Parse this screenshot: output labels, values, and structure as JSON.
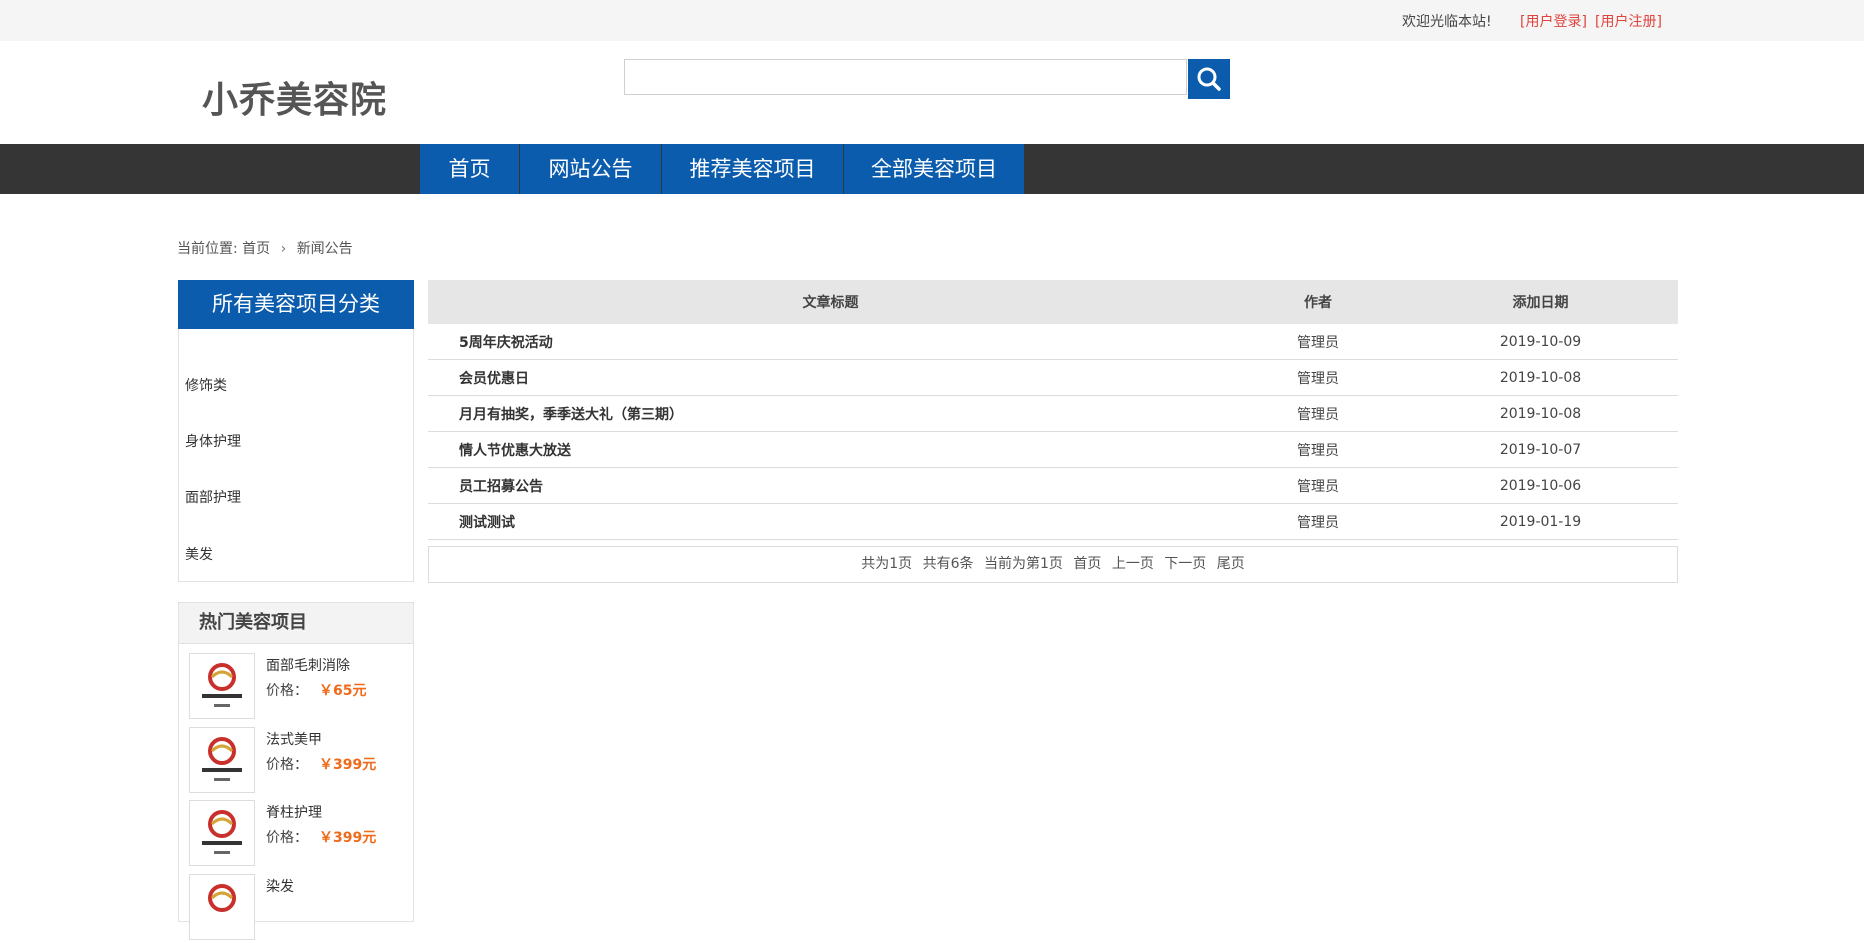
{
  "topbar": {
    "welcome": "欢迎光临本站!",
    "login": "[用户登录]",
    "register": "[用户注册]"
  },
  "header": {
    "logo": "小乔美容院",
    "search_placeholder": ""
  },
  "nav": [
    {
      "label": "首页"
    },
    {
      "label": "网站公告"
    },
    {
      "label": "推荐美容项目"
    },
    {
      "label": "全部美容项目"
    }
  ],
  "breadcrumb": {
    "prefix": "当前位置:",
    "home": "首页",
    "current": "新闻公告"
  },
  "sidebar": {
    "category_title": "所有美容项目分类",
    "categories": [
      "修饰类",
      "身体护理",
      "面部护理",
      "美发"
    ],
    "hot_title": "热门美容项目",
    "price_label": "价格：",
    "hot_items": [
      {
        "name": "面部毛刺消除",
        "price": "￥65元"
      },
      {
        "name": "法式美甲",
        "price": "￥399元"
      },
      {
        "name": "脊柱护理",
        "price": "￥399元"
      },
      {
        "name": "染发",
        "price": ""
      }
    ]
  },
  "table": {
    "headers": [
      "文章标题",
      "作者",
      "添加日期"
    ],
    "rows": [
      {
        "title": "5周年庆祝活动",
        "author": "管理员",
        "date": "2019-10-09"
      },
      {
        "title": "会员优惠日",
        "author": "管理员",
        "date": "2019-10-08"
      },
      {
        "title": "月月有抽奖，季季送大礼（第三期）",
        "author": "管理员",
        "date": "2019-10-08"
      },
      {
        "title": "情人节优惠大放送",
        "author": "管理员",
        "date": "2019-10-07"
      },
      {
        "title": "员工招募公告",
        "author": "管理员",
        "date": "2019-10-06"
      },
      {
        "title": "测试测试",
        "author": "管理员",
        "date": "2019-01-19"
      }
    ]
  },
  "pager": {
    "total_pages": "共为1页",
    "total_items": "共有6条",
    "current": "当前为第1页",
    "first": "首页",
    "prev": "上一页",
    "next": "下一页",
    "last": "尾页"
  },
  "colors": {
    "brand_blue": "#0b5cad",
    "nav_bg": "#353535",
    "link_red": "#e0443e",
    "price_orange": "#f06a1a"
  },
  "icons": {
    "search": "search-icon",
    "chevron": "chevron-right-icon",
    "thumb_logo": "tianzi-logo-icon"
  }
}
